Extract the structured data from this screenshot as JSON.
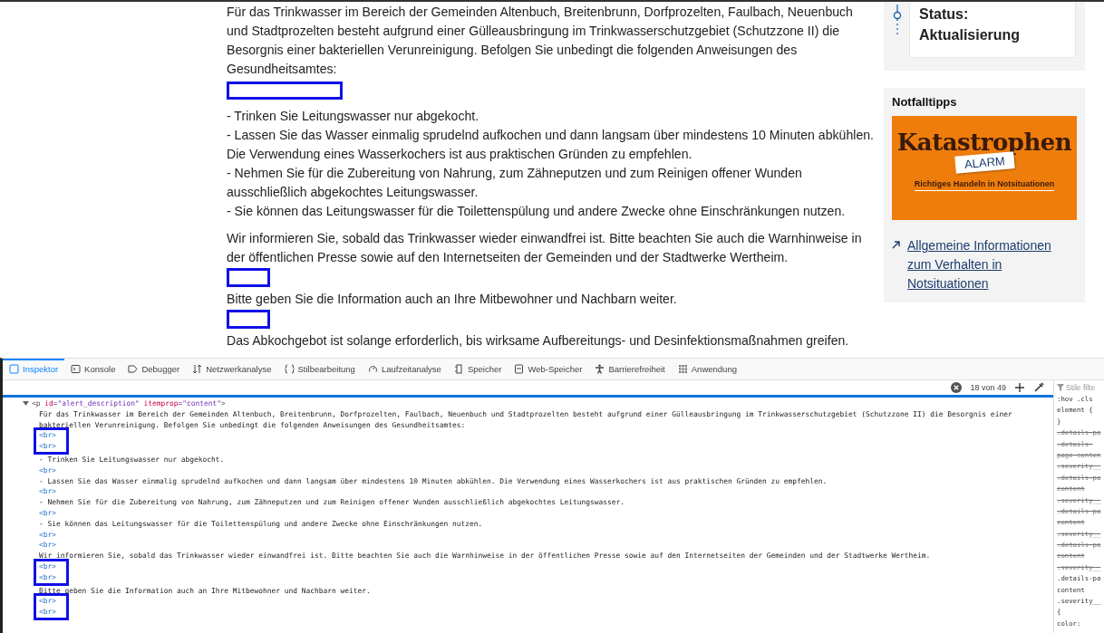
{
  "article": {
    "blocks": [
      {
        "kind": "text",
        "text": "Für das Trinkwasser im Bereich der Gemeinden Altenbuch, Breitenbrunn, Dorfprozelten, Faulbach, Neuenbuch und Stadtprozelten besteht aufgrund einer Gülleausbringung im Trinkwasserschutzgebiet (Schutzzone II) die Besorgnis einer bakteriellen Verunreinigung. Befolgen Sie unbedingt die folgenden Anweisungen des Gesundheitsamtes:"
      },
      {
        "kind": "highlight",
        "small": false
      },
      {
        "kind": "text",
        "text": "- Trinken Sie Leitungswasser nur abgekocht."
      },
      {
        "kind": "text",
        "text": "- Lassen Sie das Wasser einmalig sprudelnd aufkochen und dann langsam über mindestens 10 Minuten abkühlen. Die Verwendung eines Wasserkochers ist aus praktischen Gründen zu empfehlen."
      },
      {
        "kind": "text",
        "text": "- Nehmen Sie für die Zubereitung von Nahrung, zum Zähneputzen und zum Reinigen offener Wunden ausschließlich abgekochtes Leitungswasser."
      },
      {
        "kind": "text",
        "text": "- Sie können das Leitungswasser für die Toilettenspülung und andere Zwecke ohne Einschränkungen nutzen."
      },
      {
        "kind": "gap"
      },
      {
        "kind": "text",
        "text": "Wir informieren Sie, sobald das Trinkwasser wieder einwandfrei ist. Bitte beachten Sie auch die Warnhinweise in der öffentlichen Presse sowie auf den Internetseiten der Gemeinden und der Stadtwerke Wertheim."
      },
      {
        "kind": "highlight",
        "small": true
      },
      {
        "kind": "text",
        "text": "Bitte geben Sie die Information auch an Ihre Mitbewohner und Nachbarn weiter."
      },
      {
        "kind": "highlight",
        "small": true
      },
      {
        "kind": "text",
        "text": "Das Abkochgebot ist solange erforderlich, bis wirksame Aufbereitungs- und Desinfektionsmaßnahmen greifen."
      }
    ]
  },
  "sidebar": {
    "status_label": "Status:",
    "status_value": "Aktualisierung",
    "tips_title": "Notfalltipps",
    "banner": {
      "title": "Katastrophen",
      "tag": "ALARM",
      "subtitle": "Richtiges Handeln in Notsituationen"
    },
    "link": "Allgemeine Informationen zum Verhalten in Notsituationen"
  },
  "devtools": {
    "tabs": [
      {
        "label": "Inspektor",
        "selected": true
      },
      {
        "label": "Konsole",
        "selected": false
      },
      {
        "label": "Debugger",
        "selected": false
      },
      {
        "label": "Netzwerkanalyse",
        "selected": false
      },
      {
        "label": "Stilbearbeitung",
        "selected": false
      },
      {
        "label": "Laufzeitanalyse",
        "selected": false
      },
      {
        "label": "Speicher",
        "selected": false
      },
      {
        "label": "Web-Speicher",
        "selected": false
      },
      {
        "label": "Barrierefreiheit",
        "selected": false
      },
      {
        "label": "Anwendung",
        "selected": false
      }
    ],
    "search_count": "18 von 49",
    "filter_placeholder": "Stile filte",
    "markup": [
      {
        "kind": "tag",
        "open": "<p",
        "attributes": [
          {
            "name": "id",
            "value": "=\"alert_description\""
          },
          {
            "name": "itemprop",
            "value": "=\"content\""
          }
        ],
        "close": ">"
      },
      {
        "kind": "text",
        "text": "Für das Trinkwasser im Bereich der Gemeinden Altenbuch, Breitenbrunn, Dorfprozelten, Faulbach, Neuenbuch und Stadtprozelten besteht aufgrund einer Gülleausbringung im Trinkwasserschutzgebiet (Schutzzone II) die Besorgnis einer"
      },
      {
        "kind": "text",
        "text": "bakteriellen Verunreinigung. Befolgen Sie unbedingt die folgenden Anweisungen des Gesundheitsamtes:"
      },
      {
        "kind": "highlight",
        "children": [
          {
            "kind": "br",
            "text": "<br>"
          },
          {
            "kind": "br",
            "text": "<br>"
          }
        ]
      },
      {
        "kind": "text",
        "text": "- Trinken Sie Leitungswasser nur abgekocht."
      },
      {
        "kind": "br",
        "text": "<br>"
      },
      {
        "kind": "text",
        "text": "- Lassen Sie das Wasser einmalig sprudelnd aufkochen und dann langsam über mindestens 10 Minuten abkühlen. Die Verwendung eines Wasserkochers ist aus praktischen Gründen zu empfehlen."
      },
      {
        "kind": "br",
        "text": "<br>"
      },
      {
        "kind": "text",
        "text": "- Nehmen Sie für die Zubereitung von Nahrung, zum Zähneputzen und zum Reinigen offener Wunden ausschließlich abgekochtes Leitungswasser."
      },
      {
        "kind": "br",
        "text": "<br>"
      },
      {
        "kind": "text",
        "text": "- Sie können das Leitungswasser für die Toilettenspülung und andere Zwecke ohne Einschränkungen nutzen."
      },
      {
        "kind": "br",
        "text": "<br>"
      },
      {
        "kind": "br",
        "text": "<br>"
      },
      {
        "kind": "text",
        "text": "Wir informieren Sie, sobald das Trinkwasser wieder einwandfrei ist. Bitte beachten Sie auch die Warnhinweise in der öffentlichen Presse sowie auf den Internetseiten der Gemeinden und der Stadtwerke Wertheim."
      },
      {
        "kind": "highlight",
        "children": [
          {
            "kind": "br",
            "text": "<br>"
          },
          {
            "kind": "br",
            "text": "<br>"
          }
        ]
      },
      {
        "kind": "text",
        "text": "Bitte geben Sie die Information auch an Ihre Mitbewohner und Nachbarn weiter."
      },
      {
        "kind": "highlight",
        "children": [
          {
            "kind": "br",
            "text": "<br>"
          },
          {
            "kind": "br",
            "text": "<br>"
          }
        ]
      }
    ],
    "rules": [
      {
        "text": ":hov .cls",
        "struck": false
      },
      {
        "text": "element {",
        "struck": false
      },
      {
        "text": "}",
        "struck": false
      },
      {
        "text": ".details-pa",
        "struck": true
      },
      {
        "text": ".details-",
        "struck": true
      },
      {
        "text": "page-conten",
        "struck": true
      },
      {
        "text": ".severity__",
        "struck": true
      },
      {
        "text": ".details-pa",
        "struck": true
      },
      {
        "text": "content",
        "struck": true
      },
      {
        "text": ".severity__",
        "struck": true
      },
      {
        "text": ".details-pa",
        "struck": true
      },
      {
        "text": "content",
        "struck": true
      },
      {
        "text": ".severity__",
        "struck": true
      },
      {
        "text": ".details-pa",
        "struck": true
      },
      {
        "text": "content",
        "struck": true
      },
      {
        "text": ".severity__",
        "struck": true
      },
      {
        "text": ".details-pa",
        "struck": false
      },
      {
        "text": "content",
        "struck": false
      },
      {
        "text": ".severity__",
        "struck": false
      },
      {
        "text": "{",
        "struck": false
      },
      {
        "text": "color:",
        "struck": false
      }
    ]
  }
}
